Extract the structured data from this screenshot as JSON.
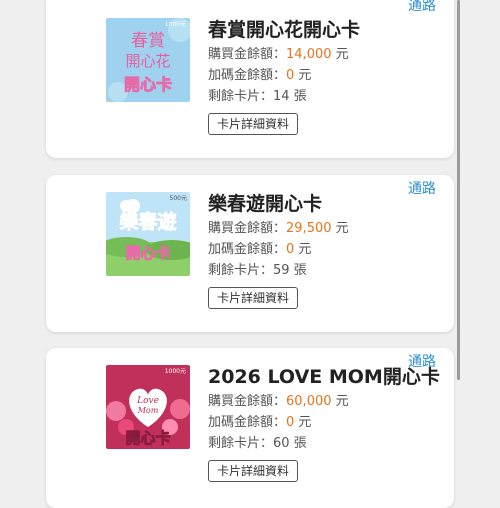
{
  "cards": [
    {
      "channel": "通路",
      "title": "春賞開心花開心卡",
      "purchase_label": "購買金餘額：",
      "purchase_value": "14,000",
      "purchase_unit": " 元",
      "bonus_label": "加碼金餘額：",
      "bonus_value": "0",
      "bonus_unit": " 元",
      "remaining_label": "剩餘卡片：",
      "remaining_value": "14",
      "remaining_unit": " 張",
      "detail_button": "卡片詳細資料",
      "thumb": {
        "badge": "1000元",
        "line1": "春賞",
        "line2": "開心花",
        "line3": "開心卡"
      }
    },
    {
      "channel": "通路",
      "title": "樂春遊開心卡",
      "purchase_label": "購買金餘額：",
      "purchase_value": "29,500",
      "purchase_unit": " 元",
      "bonus_label": "加碼金餘額：",
      "bonus_value": "0",
      "bonus_unit": " 元",
      "remaining_label": "剩餘卡片：",
      "remaining_value": "59",
      "remaining_unit": " 張",
      "detail_button": "卡片詳細資料",
      "thumb": {
        "badge": "500元",
        "line1": "樂春遊",
        "line2": "開心卡"
      }
    },
    {
      "channel": "通路",
      "title": "2026 LOVE MOM開心卡",
      "purchase_label": "購買金餘額：",
      "purchase_value": "60,000",
      "purchase_unit": " 元",
      "bonus_label": "加碼金餘額：",
      "bonus_value": "0",
      "bonus_unit": " 元",
      "remaining_label": "剩餘卡片：",
      "remaining_value": "60",
      "remaining_unit": " 張",
      "detail_button": "卡片詳細資料",
      "thumb": {
        "badge": "1000元",
        "line1": "Love",
        "line2": "Mom",
        "line3": "開心卡"
      }
    }
  ],
  "colors": {
    "accent": "#2a8fd6",
    "value": "#e8731c"
  }
}
